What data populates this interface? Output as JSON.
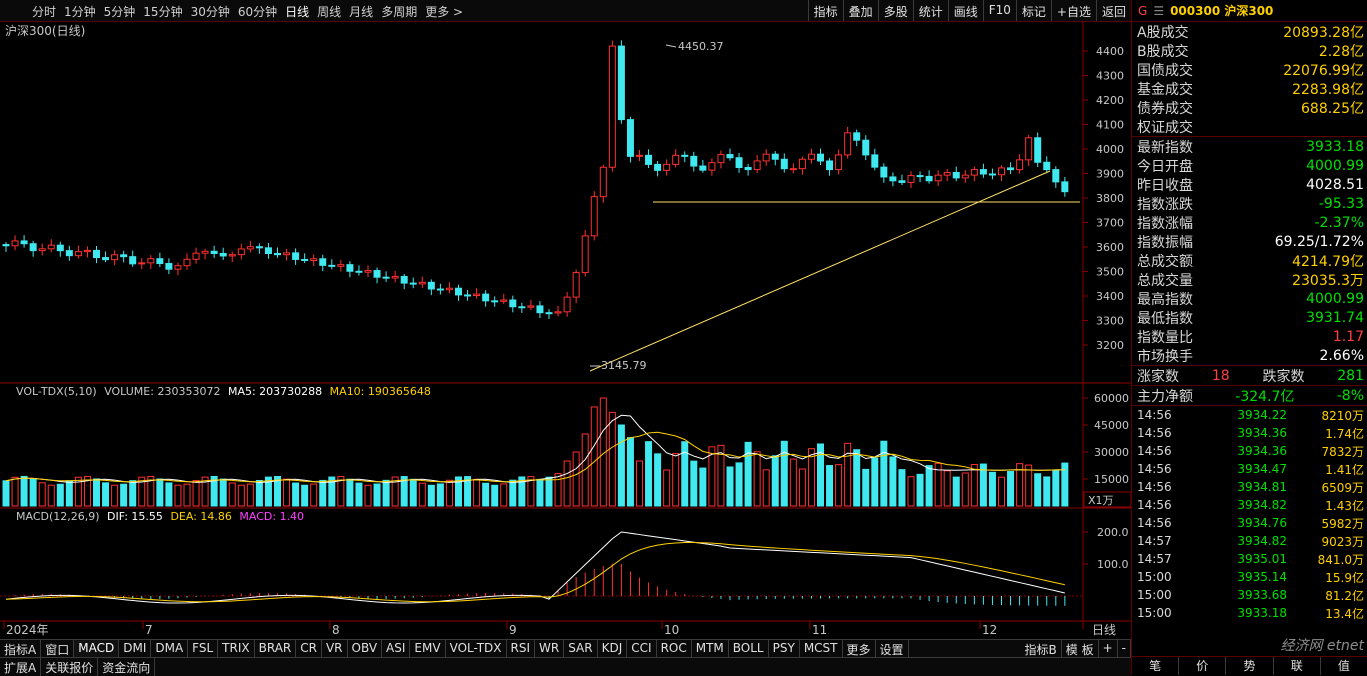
{
  "periods": [
    "分时",
    "1分钟",
    "5分钟",
    "15分钟",
    "30分钟",
    "60分钟",
    "日线",
    "周线",
    "月线",
    "多周期",
    "更多 >"
  ],
  "active_period": "日线",
  "tools": [
    "指标",
    "叠加",
    "多股",
    "统计",
    "画线",
    "F10",
    "标记",
    "+自选",
    "返回"
  ],
  "main_title": "沪深300(日线)",
  "peak_label": "4450.37",
  "low_label": "3145.79",
  "price_axis": [
    "4400",
    "4300",
    "4200",
    "4100",
    "4000",
    "3900",
    "3800",
    "3700",
    "3600",
    "3500",
    "3400",
    "3300",
    "3200"
  ],
  "vol_header": {
    "name": "VOL-TDX(5,10)",
    "volume": "VOLUME: 230353072",
    "ma5": "MA5: 203730288",
    "ma10": "MA10: 190365648"
  },
  "vol_axis": [
    "60000",
    "45000",
    "30000",
    "15000"
  ],
  "vol_unit": "X1万",
  "macd_header": {
    "name": "MACD(12,26,9)",
    "dif": "DIF: 15.55",
    "dea": "DEA: 14.86",
    "macd": "MACD: 1.40"
  },
  "macd_axis": [
    "200.0",
    "100.0"
  ],
  "date_axis": [
    "2024年",
    "7",
    "8",
    "9",
    "10",
    "11",
    "12"
  ],
  "date_axis_right": "日线",
  "indicators": [
    "指标A",
    "窗口",
    "MACD",
    "DMI",
    "DMA",
    "FSL",
    "TRIX",
    "BRAR",
    "CR",
    "VR",
    "OBV",
    "ASI",
    "EMV",
    "VOL-TDX",
    "RSI",
    "WR",
    "SAR",
    "KDJ",
    "CCI",
    "ROC",
    "MTM",
    "BOLL",
    "PSY",
    "MCST",
    "更多",
    "设置"
  ],
  "indicators_right": [
    "指标B",
    "模 板",
    "+",
    "-"
  ],
  "active_indicator": "MACD",
  "bottom2": [
    "扩展A",
    "关联报价",
    "资金流向"
  ],
  "right_panel": {
    "flag": "G",
    "menu": "☰",
    "code": "000300 沪深300",
    "rows1": [
      {
        "label": "A股成交",
        "value": "20893.28亿"
      },
      {
        "label": "B股成交",
        "value": "2.28亿"
      },
      {
        "label": "国债成交",
        "value": "22076.99亿"
      },
      {
        "label": "基金成交",
        "value": "2283.98亿"
      },
      {
        "label": "债券成交",
        "value": "688.25亿"
      },
      {
        "label": "权证成交",
        "value": ""
      }
    ],
    "rows2": [
      {
        "label": "最新指数",
        "value": "3933.18",
        "color": "#00e000"
      },
      {
        "label": "今日开盘",
        "value": "4000.99",
        "color": "#00e000"
      },
      {
        "label": "昨日收盘",
        "value": "4028.51",
        "color": "#ffffff"
      },
      {
        "label": "指数涨跌",
        "value": "-95.33",
        "color": "#00e000"
      },
      {
        "label": "指数涨幅",
        "value": "-2.37%",
        "color": "#00e000"
      },
      {
        "label": "指数振幅",
        "value": "69.25/1.72%",
        "color": "#ffffff"
      },
      {
        "label": "总成交额",
        "value": "4214.79亿",
        "color": "#ffd000"
      },
      {
        "label": "总成交量",
        "value": "23035.3万",
        "color": "#ffd000"
      },
      {
        "label": "最高指数",
        "value": "4000.99",
        "color": "#00e000"
      },
      {
        "label": "最低指数",
        "value": "3931.74",
        "color": "#00e000"
      },
      {
        "label": "指数量比",
        "value": "1.17",
        "color": "#ff4040"
      },
      {
        "label": "市场换手",
        "value": "2.66%",
        "color": "#ffffff"
      }
    ],
    "updown": {
      "up_label": "涨家数",
      "up": "18",
      "down_label": "跌家数",
      "down": "281"
    },
    "mainflow": {
      "label": "主力净额",
      "value": "-324.7亿",
      "pct": "-8%"
    },
    "ticks": [
      {
        "t": "14:56",
        "p": "3934.22",
        "v": "8210万"
      },
      {
        "t": "14:56",
        "p": "3934.36",
        "v": "1.74亿"
      },
      {
        "t": "14:56",
        "p": "3934.36",
        "v": "7832万"
      },
      {
        "t": "14:56",
        "p": "3934.47",
        "v": "1.41亿"
      },
      {
        "t": "14:56",
        "p": "3934.81",
        "v": "6509万"
      },
      {
        "t": "14:56",
        "p": "3934.82",
        "v": "1.43亿"
      },
      {
        "t": "14:56",
        "p": "3934.76",
        "v": "5982万"
      },
      {
        "t": "14:57",
        "p": "3934.82",
        "v": "9023万"
      },
      {
        "t": "14:57",
        "p": "3935.01",
        "v": "841.0万"
      },
      {
        "t": "15:00",
        "p": "3935.14",
        "v": "15.9亿"
      },
      {
        "t": "15:00",
        "p": "3933.68",
        "v": "81.2亿"
      },
      {
        "t": "15:00",
        "p": "3933.18",
        "v": "13.4亿"
      }
    ],
    "tabs": [
      "笔",
      "价",
      "势",
      "联",
      "值"
    ],
    "watermark": "经济网 etnet"
  }
}
